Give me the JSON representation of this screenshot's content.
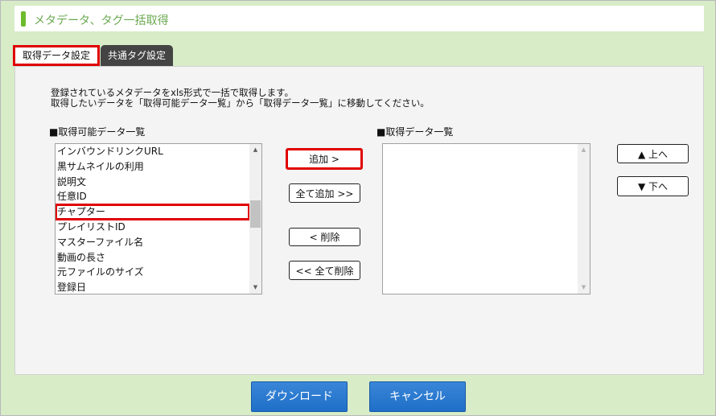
{
  "header": {
    "title": "メタデータ、タグ一括取得"
  },
  "tabs": [
    {
      "label": "取得データ設定",
      "active": true
    },
    {
      "label": "共通タグ設定",
      "active": false
    }
  ],
  "description": {
    "line1": "登録されているメタデータをxls形式で一括で取得します。",
    "line2": "取得したいデータを「取得可能データ一覧」から「取得データ一覧」に移動してください。"
  },
  "available_list": {
    "label": "■取得可能データ一覧",
    "items": [
      "インバウンドリンクURL",
      "黒サムネイルの利用",
      "説明文",
      "任意ID",
      "チャプター",
      "プレイリストID",
      "マスターファイル名",
      "動画の長さ",
      "元ファイルのサイズ",
      "登録日"
    ],
    "selected_item": "チャプター"
  },
  "selected_list": {
    "label": "■取得データ一覧",
    "items": []
  },
  "transfer_buttons": {
    "add": "追加 >",
    "add_all": "全て追加 >>",
    "remove": "< 削除",
    "remove_all": "<< 全て削除"
  },
  "order_buttons": {
    "up": "▲ 上へ",
    "down": "▼ 下へ"
  },
  "footer": {
    "download": "ダウンロード",
    "cancel": "キャンセル"
  },
  "colors": {
    "accent_green": "#6cbb2c",
    "highlight_red": "#e00000",
    "primary_blue": "#1e6fc8"
  }
}
